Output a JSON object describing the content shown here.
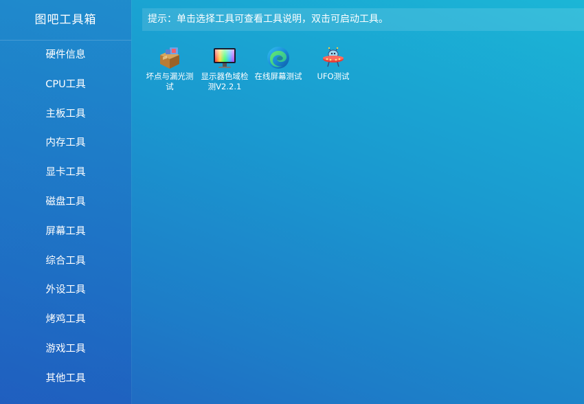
{
  "sidebar": {
    "title": "图吧工具箱",
    "items": [
      {
        "label": "硬件信息"
      },
      {
        "label": "CPU工具"
      },
      {
        "label": "主板工具"
      },
      {
        "label": "内存工具"
      },
      {
        "label": "显卡工具"
      },
      {
        "label": "磁盘工具"
      },
      {
        "label": "屏幕工具"
      },
      {
        "label": "综合工具"
      },
      {
        "label": "外设工具"
      },
      {
        "label": "烤鸡工具"
      },
      {
        "label": "游戏工具"
      },
      {
        "label": "其他工具"
      }
    ]
  },
  "tip": "提示：单击选择工具可查看工具说明，双击可启动工具。",
  "tools": [
    {
      "label": "坏点与漏光测试",
      "icon": "package-box-icon"
    },
    {
      "label": "显示器色域检测V2.2.1",
      "icon": "color-monitor-icon"
    },
    {
      "label": "在线屏幕测试",
      "icon": "edge-browser-icon"
    },
    {
      "label": "UFO测试",
      "icon": "ufo-icon"
    }
  ]
}
